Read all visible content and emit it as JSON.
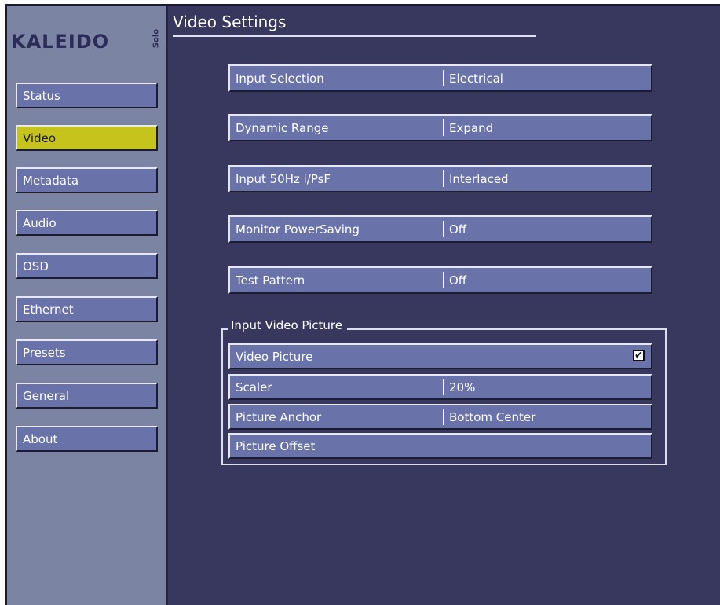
{
  "logo": {
    "word": "KALEIDO",
    "sub": "Solo"
  },
  "page_title": "Video Settings",
  "nav": [
    {
      "label": "Status",
      "active": false
    },
    {
      "label": "Video",
      "active": true
    },
    {
      "label": "Metadata",
      "active": false
    },
    {
      "label": "Audio",
      "active": false
    },
    {
      "label": "OSD",
      "active": false
    },
    {
      "label": "Ethernet",
      "active": false
    },
    {
      "label": "Presets",
      "active": false
    },
    {
      "label": "General",
      "active": false
    },
    {
      "label": "About",
      "active": false
    }
  ],
  "settings": [
    {
      "label": "Input Selection",
      "value": "Electrical"
    },
    {
      "label": "Dynamic Range",
      "value": "Expand"
    },
    {
      "label": "Input 50Hz i/PsF",
      "value": "Interlaced"
    },
    {
      "label": "Monitor PowerSaving",
      "value": "Off"
    },
    {
      "label": "Test Pattern",
      "value": "Off"
    }
  ],
  "group": {
    "legend": "Input Video Picture",
    "video_picture": {
      "label": "Video Picture",
      "checked": true,
      "check_glyph": "✔"
    },
    "scaler": {
      "label": "Scaler",
      "value": "20%"
    },
    "anchor": {
      "label": "Picture Anchor",
      "value": "Bottom Center"
    },
    "offset": {
      "label": "Picture Offset"
    }
  },
  "colors": {
    "background": "#38385f",
    "sidebar": "#7c84a4",
    "button": "#6a72aa",
    "active_button": "#c6c41c"
  }
}
